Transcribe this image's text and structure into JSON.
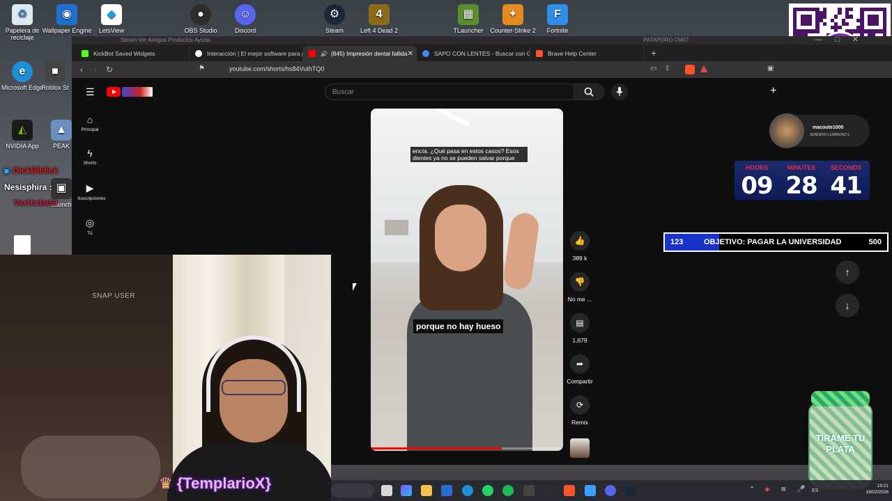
{
  "desktop": {
    "icons": [
      {
        "label": "Papelera de reciclaje",
        "icon": "recycle-bin-icon",
        "color": "#3d82c4"
      },
      {
        "label": "Wallpaper Engine",
        "icon": "wallpaper-engine-icon",
        "color": "#1f6fd1"
      },
      {
        "label": "LetsView",
        "icon": "letsview-icon",
        "color": "#12a3e8"
      },
      {
        "label": "OBS Studio",
        "icon": "obs-icon",
        "color": "#2d2d2d"
      },
      {
        "label": "Discord",
        "icon": "discord-icon",
        "color": "#5865f2"
      },
      {
        "label": "Steam",
        "icon": "steam-icon",
        "color": "#1b2838"
      },
      {
        "label": "Left 4 Dead 2",
        "icon": "left4dead-icon",
        "color": "#8a6b1c"
      },
      {
        "label": "TLauncher",
        "icon": "tlauncher-icon",
        "color": "#5a8f2c"
      },
      {
        "label": "Counter-Strike 2",
        "icon": "cs2-icon",
        "color": "#e58a1f"
      },
      {
        "label": "Fortnite",
        "icon": "fortnite-icon",
        "color": "#2f8fe8"
      },
      {
        "label": "Microsoft Edge",
        "icon": "edge-icon",
        "color": "#1d8fd8"
      },
      {
        "label": "Roblox St",
        "icon": "roblox-icon",
        "color": "#444444"
      },
      {
        "label": "NVIDIA App",
        "icon": "nvidia-icon",
        "color": "#76b900"
      },
      {
        "label": "PEAK",
        "icon": "peak-icon",
        "color": "#6c8fbf"
      },
      {
        "label": "Launch",
        "icon": "launcher-icon",
        "color": "#333333"
      }
    ]
  },
  "browser": {
    "bg_title": "Steam   Ver   Amigos   Productos   Ayuda",
    "bg_window": "PATAPORO OWO",
    "tabs": [
      {
        "label": "KickBot Saved Widgets",
        "color": "#53fc18",
        "active": false
      },
      {
        "label": "Interacción | El mejor software para p",
        "color": "#ffffff",
        "active": false
      },
      {
        "label": "(845) Impresión dental fallida",
        "color": "#ff0000",
        "active": true
      },
      {
        "label": "SAPO CON LENTES - Buscar con Goo",
        "color": "#4285f4",
        "active": false
      },
      {
        "label": "Brave Help Center",
        "color": "#fb542b",
        "active": false
      }
    ],
    "url": "youtube.com/shorts/hs84VuIhTQ0"
  },
  "youtube": {
    "search_placeholder": "Buscar",
    "sidebar": [
      {
        "label": "Principal",
        "icon": "home-icon"
      },
      {
        "label": "Shorts",
        "icon": "shorts-icon"
      },
      {
        "label": "Suscripciones",
        "icon": "subscriptions-icon"
      },
      {
        "label": "Tú",
        "icon": "you-icon"
      }
    ],
    "video": {
      "caption_top": "encía. ¿Qué pasa en estos casos? Esos dientes ya no se pueden salvar porque",
      "caption_bottom": "porque no hay hueso",
      "progress": 0.68
    },
    "actions": {
      "like_count": "389 k",
      "dislike_label": "No me ...",
      "comments_count": "1,679",
      "share_label": "Compartir",
      "remix_label": "Remix"
    }
  },
  "overlays": {
    "qr_text": "yape",
    "streamer": {
      "name": "macoute1000",
      "subtitle": "SENDERO LUMINOSO 1"
    },
    "timer": {
      "labels": [
        "HOURS",
        "MINUTES",
        "SECONDS"
      ],
      "values": [
        "09",
        "28",
        "41"
      ]
    },
    "goal": {
      "current": "123",
      "text": "OBJETIVO: PAGAR LA UNIVERSIDAD",
      "target": "500",
      "fill": 0.246
    },
    "chat": [
      {
        "text": "DickBiblick",
        "color": "#e0202a"
      },
      {
        "text": "Nesisphira :",
        "color": "#ffffff"
      },
      {
        "text": "VaxHadar69",
        "color": "#d21f4a"
      }
    ],
    "webcam_text": "SNAP USER",
    "streamer_name": "{TemplarioX}",
    "jar_text": "TIRAME TU PLATA"
  },
  "taskbar": {
    "clock_time": "19:21",
    "clock_date": "19/02/2026",
    "lang": "ES"
  }
}
